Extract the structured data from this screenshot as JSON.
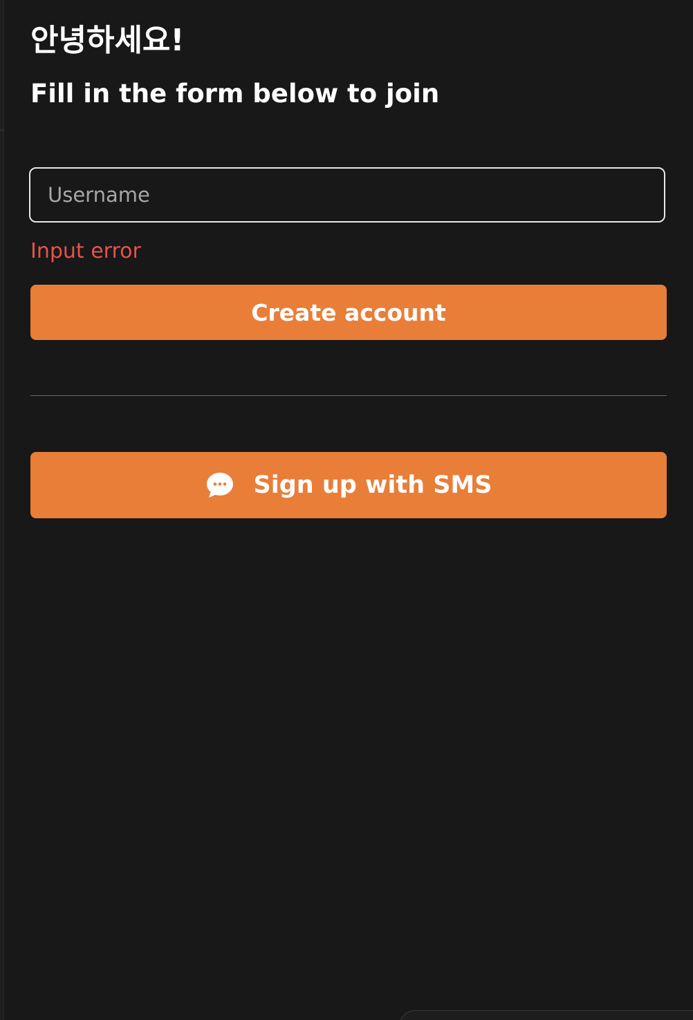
{
  "header": {
    "greeting": "안녕하세요!",
    "subtitle": "Fill in the form below to join"
  },
  "form": {
    "username_placeholder": "Username",
    "username_value": "",
    "error_text": "Input error",
    "create_button_label": "Create account",
    "sms_button_label": "Sign up with SMS",
    "sms_icon": "chat-bubble-icon"
  },
  "colors": {
    "accent": "#e97e38",
    "error": "#e5534b",
    "background": "#181818"
  }
}
